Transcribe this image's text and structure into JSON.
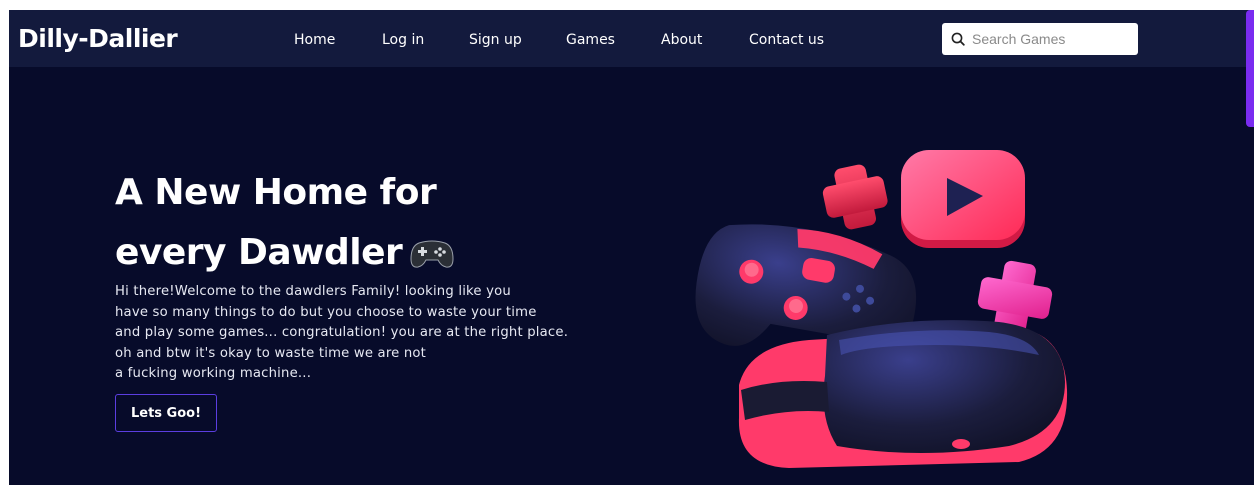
{
  "header": {
    "brand": "Dilly-Dallier",
    "nav": [
      "Home",
      "Log in",
      "Sign up",
      "Games",
      "About",
      "Contact us"
    ],
    "search": {
      "placeholder": "Search Games",
      "value": ""
    }
  },
  "hero": {
    "title_line1": "A New Home for",
    "title_line2": "every Dawdler",
    "description_lines": [
      "Hi there!Welcome to the dawdlers Family! looking like you",
      "have so many things to do but you choose to waste your time",
      "and play some games... congratulation! you are at the right place.",
      "oh and btw it's okay to waste time we are not",
      "a fucking working machine..."
    ],
    "cta_label": "Lets Goo!"
  },
  "icons": {
    "search": "search-icon",
    "title_emoji": "game-controller-icon",
    "illustration": "gaming-controller-vr-illustration"
  },
  "colors": {
    "page_bg": "#070b2a",
    "navbar_bg": "#131a3d",
    "accent_button_border": "#5b3ee0",
    "scrollbar": "#7a2cf0",
    "illustration_pink": "#ff3a6a"
  }
}
